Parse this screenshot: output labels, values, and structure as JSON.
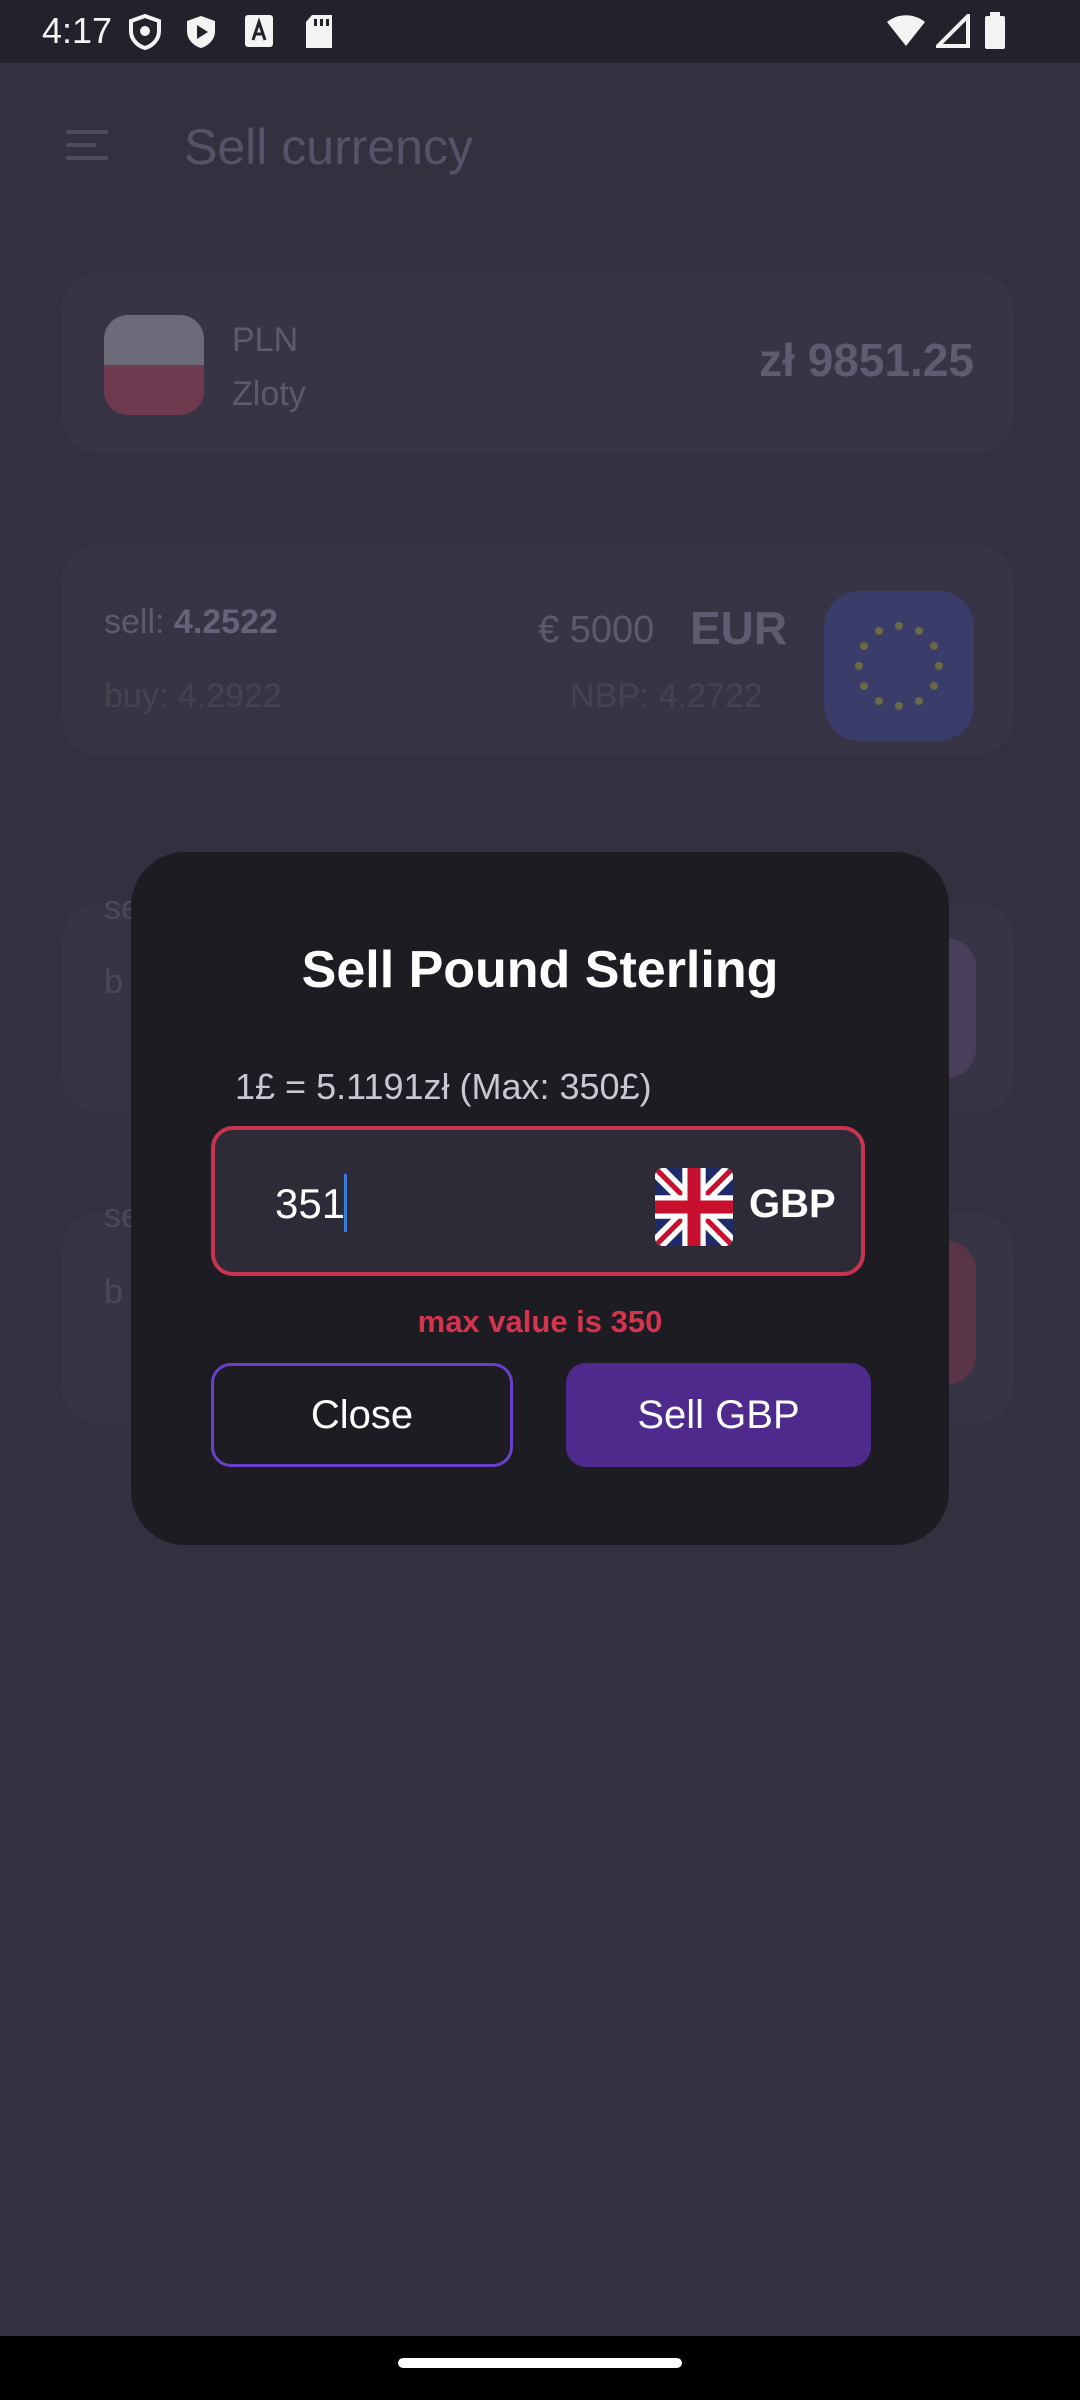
{
  "status_bar": {
    "time": "4:17",
    "icons": [
      "shield-icon",
      "play-store-icon",
      "font-a-icon",
      "sd-card-icon",
      "wifi-icon",
      "signal-icon",
      "battery-icon"
    ]
  },
  "app": {
    "title": "Sell currency",
    "base_currency": {
      "code": "PLN",
      "name": "Zloty",
      "balance": "zł 9851.25"
    },
    "eur": {
      "sell_prefix": "sell: ",
      "sell_rate": "4.2522",
      "buy": "buy: 4.2922",
      "amount": "€ 5000",
      "code": "EUR",
      "nbp": "NBP: 4.2722"
    },
    "partial_rows": [
      {
        "sell_frag": "se",
        "buy_frag": "b"
      },
      {
        "sell_frag": "se",
        "buy_frag": "b"
      }
    ]
  },
  "dialog": {
    "title": "Sell Pound Sterling",
    "rate_line": "1£ = 5.1191zł (Max: 350£)",
    "amount_value": "351",
    "currency_code": "GBP",
    "error": "max value is 350",
    "close_label": "Close",
    "sell_label": "Sell GBP"
  },
  "colors": {
    "accent": "#4d2a8c",
    "error": "#d5344f",
    "dialog_bg": "#1d1c22"
  }
}
